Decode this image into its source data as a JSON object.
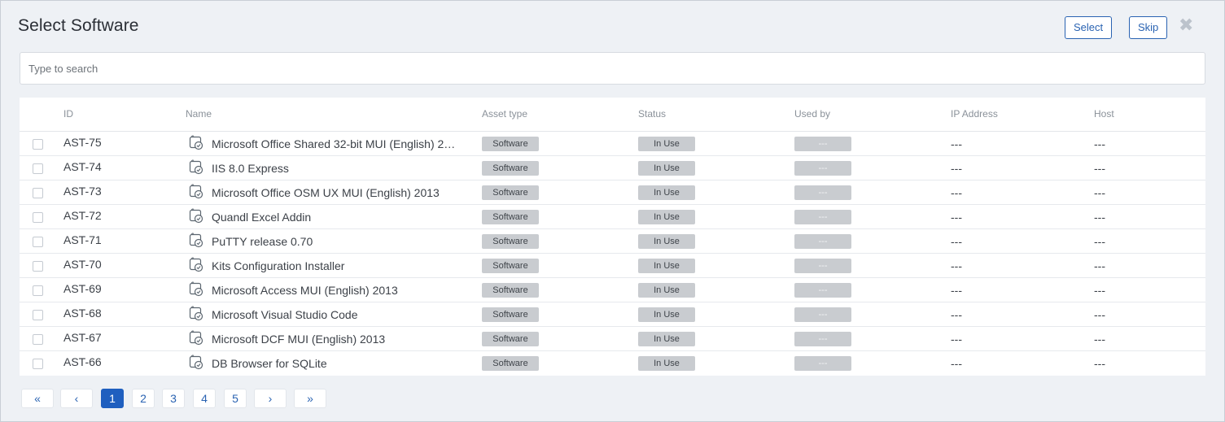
{
  "dialog": {
    "title": "Select Software",
    "select_label": "Select",
    "skip_label": "Skip",
    "close_icon": "close-icon",
    "accent_color": "#2a63b2"
  },
  "search": {
    "placeholder": "Type to search",
    "value": ""
  },
  "table": {
    "columns": [
      "ID",
      "Name",
      "Asset type",
      "Status",
      "Used by",
      "IP Address",
      "Host"
    ],
    "rows": [
      {
        "id": "AST-75",
        "name": "Microsoft Office Shared 32-bit MUI (English) 2…",
        "type": "Software",
        "status": "In Use",
        "used_by": "---",
        "ip": "---",
        "host": "---"
      },
      {
        "id": "AST-74",
        "name": "IIS 8.0 Express",
        "type": "Software",
        "status": "In Use",
        "used_by": "---",
        "ip": "---",
        "host": "---"
      },
      {
        "id": "AST-73",
        "name": "Microsoft Office OSM UX MUI (English) 2013",
        "type": "Software",
        "status": "In Use",
        "used_by": "---",
        "ip": "---",
        "host": "---"
      },
      {
        "id": "AST-72",
        "name": "Quandl Excel Addin",
        "type": "Software",
        "status": "In Use",
        "used_by": "---",
        "ip": "---",
        "host": "---"
      },
      {
        "id": "AST-71",
        "name": "PuTTY release 0.70",
        "type": "Software",
        "status": "In Use",
        "used_by": "---",
        "ip": "---",
        "host": "---"
      },
      {
        "id": "AST-70",
        "name": "Kits Configuration Installer",
        "type": "Software",
        "status": "In Use",
        "used_by": "---",
        "ip": "---",
        "host": "---"
      },
      {
        "id": "AST-69",
        "name": "Microsoft Access MUI (English) 2013",
        "type": "Software",
        "status": "In Use",
        "used_by": "---",
        "ip": "---",
        "host": "---"
      },
      {
        "id": "AST-68",
        "name": "Microsoft Visual Studio Code",
        "type": "Software",
        "status": "In Use",
        "used_by": "---",
        "ip": "---",
        "host": "---"
      },
      {
        "id": "AST-67",
        "name": "Microsoft DCF MUI (English) 2013",
        "type": "Software",
        "status": "In Use",
        "used_by": "---",
        "ip": "---",
        "host": "---"
      },
      {
        "id": "AST-66",
        "name": "DB Browser for SQLite",
        "type": "Software",
        "status": "In Use",
        "used_by": "---",
        "ip": "---",
        "host": "---"
      }
    ]
  },
  "pagination": {
    "first": "«",
    "prev": "‹",
    "pages": [
      "1",
      "2",
      "3",
      "4",
      "5"
    ],
    "current": "1",
    "next": "›",
    "last": "»"
  }
}
